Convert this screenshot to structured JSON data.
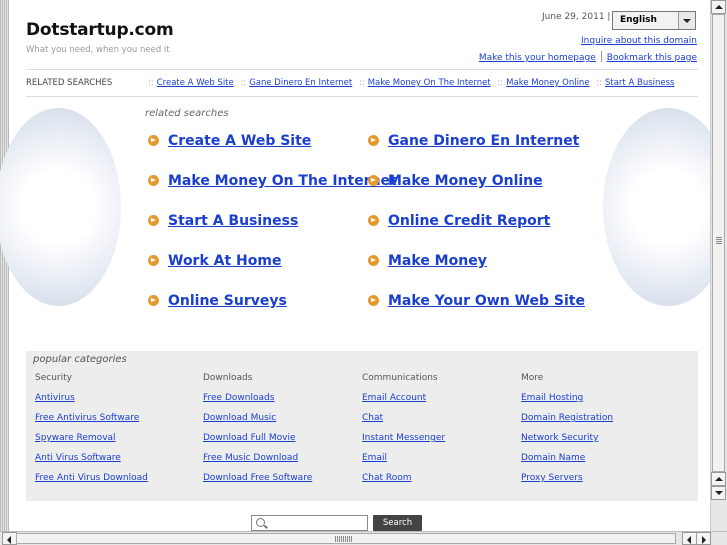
{
  "header": {
    "site_title": "Dotstartup.com",
    "tagline": "What you need, when you need it",
    "date": "June 29, 2011 |",
    "language": "English",
    "inquire": "Inquire about this domain",
    "make_homepage": "Make this your homepage",
    "bookmark": "Bookmark this page"
  },
  "related_bar": {
    "label": "RELATED SEARCHES",
    "separator": "::",
    "links": [
      "Create A Web Site",
      "Gane Dinero En Internet",
      "Make Money On The Internet",
      "Make Money Online",
      "Start A Business"
    ]
  },
  "related": {
    "heading": "related searches",
    "left": [
      "Create A Web Site",
      "Make Money On The Internet",
      "Start A Business",
      "Work At Home",
      "Online Surveys"
    ],
    "right": [
      "Gane Dinero En Internet",
      "Make Money Online",
      "Online Credit Report",
      "Make Money",
      "Make Your Own Web Site"
    ]
  },
  "popular": {
    "title": "popular categories",
    "columns": [
      {
        "header": "Security",
        "links": [
          "Antivirus",
          "Free Antivirus Software",
          "Spyware Removal",
          "Anti Virus Software",
          "Free Anti Virus Download"
        ]
      },
      {
        "header": "Downloads",
        "links": [
          "Free Downloads",
          "Download Music",
          "Download Full Movie",
          "Free Music Download",
          "Download Free Software"
        ]
      },
      {
        "header": "Communications",
        "links": [
          "Email Account",
          "Chat",
          "Instant Messenger",
          "Email",
          "Chat Room"
        ]
      },
      {
        "header": "More",
        "links": [
          "Email Hosting",
          "Domain Registration",
          "Network Security",
          "Domain Name",
          "Proxy Servers"
        ]
      }
    ]
  },
  "search": {
    "value": "",
    "button": "Search"
  }
}
